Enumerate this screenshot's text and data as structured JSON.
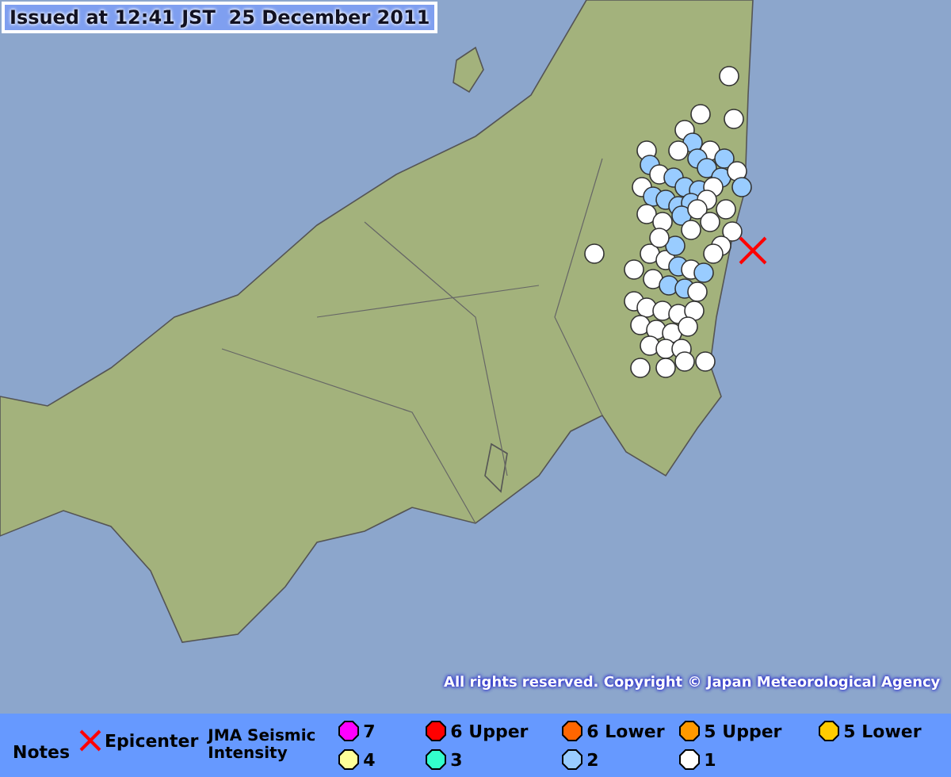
{
  "title": "Issued at 12:41 JST  25 December 2011",
  "copyright": "All rights reserved. Copyright © Japan Meteorological Agency",
  "legend": {
    "notes_label": "Notes",
    "epicenter_label": "Epicenter",
    "scale_title": "JMA Seismic Intensity",
    "intensities": [
      {
        "label": "7",
        "color": "#ff00ff"
      },
      {
        "label": "6 Upper",
        "color": "#ff0000"
      },
      {
        "label": "6 Lower",
        "color": "#ff6600"
      },
      {
        "label": "5 Upper",
        "color": "#ff9900"
      },
      {
        "label": "5 Lower",
        "color": "#ffcc00"
      },
      {
        "label": "4",
        "color": "#ffff99"
      },
      {
        "label": "3",
        "color": "#33ffcc"
      },
      {
        "label": "2",
        "color": "#99ccff"
      },
      {
        "label": "1",
        "color": "#ffffff"
      }
    ]
  }
}
